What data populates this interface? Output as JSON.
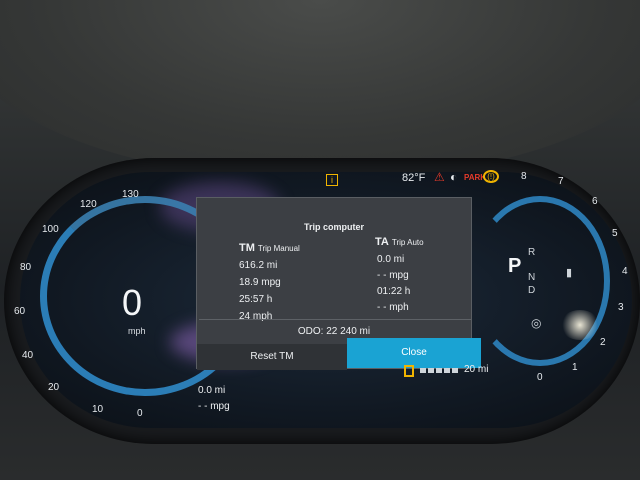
{
  "cluster": {
    "speedometer": {
      "ticks": [
        "130",
        "120",
        "100",
        "80",
        "60",
        "40",
        "20",
        "10",
        "0"
      ],
      "current_speed": "0",
      "unit": "mph"
    },
    "tachometer": {
      "ticks": [
        "8",
        "7",
        "6",
        "5",
        "4",
        "3",
        "2",
        "1",
        "0"
      ]
    },
    "outside_temp": "82°F",
    "park_indicator": "PARK",
    "brake_indicator": "(!)",
    "gear": {
      "r": "R",
      "p": "P",
      "n": "N",
      "d": "D"
    },
    "bottom_left": {
      "distance": "0.0 mi",
      "economy": "- - mpg"
    },
    "bottom_right": {
      "range": "20 mi"
    },
    "colors": {
      "accent_blue": "#2f89c7",
      "close_button": "#1aa3d3",
      "warning_amber": "#f0b400",
      "park_red": "#e53b2a"
    }
  },
  "trip_computer": {
    "title": "Trip computer",
    "manual": {
      "code": "TM",
      "label": "Trip Manual",
      "distance": "616.2 mi",
      "economy": "18.9 mpg",
      "time": "25:57 h",
      "avg_speed": "24 mph"
    },
    "auto": {
      "code": "TA",
      "label": "Trip Auto",
      "distance": "0.0 mi",
      "economy": "- - mpg",
      "time": "01:22 h",
      "avg_speed": "- - mph"
    },
    "odometer": "ODO:  22 240 mi",
    "reset_label": "Reset TM",
    "close_label": "Close"
  }
}
